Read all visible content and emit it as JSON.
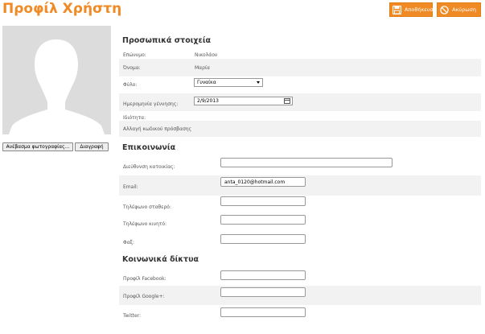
{
  "header": {
    "title": "Προφίλ Χρήστη",
    "save_label": "Αποθήκευση",
    "cancel_label": "Ακύρωση"
  },
  "photo": {
    "upload_label": "Ανέβασμα φωτογραφίας...",
    "delete_label": "Διαγραφή"
  },
  "personal": {
    "title": "Προσωπικά στοιχεία",
    "surname_label": "Επώνυμο:",
    "surname_value": "Νικολάου",
    "name_label": "Όνομα:",
    "name_value": "Μαρία",
    "gender_label": "Φύλο:",
    "gender_value": "Γυναίκα",
    "birthdate_label": "Ημερομηνία γέννησης:",
    "birthdate_value": "2/9/2013",
    "role_label": "Ιδιότητα:",
    "password_label": "Αλλαγή κωδικού πρόσβασης"
  },
  "contact": {
    "title": "Επικοινωνία",
    "address_label": "Διεύθυνση κατοικίας:",
    "address_value": "",
    "email_label": "Email:",
    "email_value": "anta_0120@hotmail.com",
    "phone_label": "Τηλέφωνο σταθερό:",
    "phone_value": "",
    "mobile_label": "Τηλέφωνο κινητό:",
    "mobile_value": "",
    "fax_label": "Φαξ:",
    "fax_value": ""
  },
  "social": {
    "title": "Κοινωνικά δίκτυα",
    "facebook_label": "Προφίλ Facebook:",
    "facebook_value": "",
    "google_label": "Προφίλ Google+:",
    "google_value": "",
    "twitter_label": "Twitter:",
    "twitter_value": ""
  },
  "colors": {
    "accent": "#f08a24",
    "row_alt": "#f2f2f2"
  }
}
